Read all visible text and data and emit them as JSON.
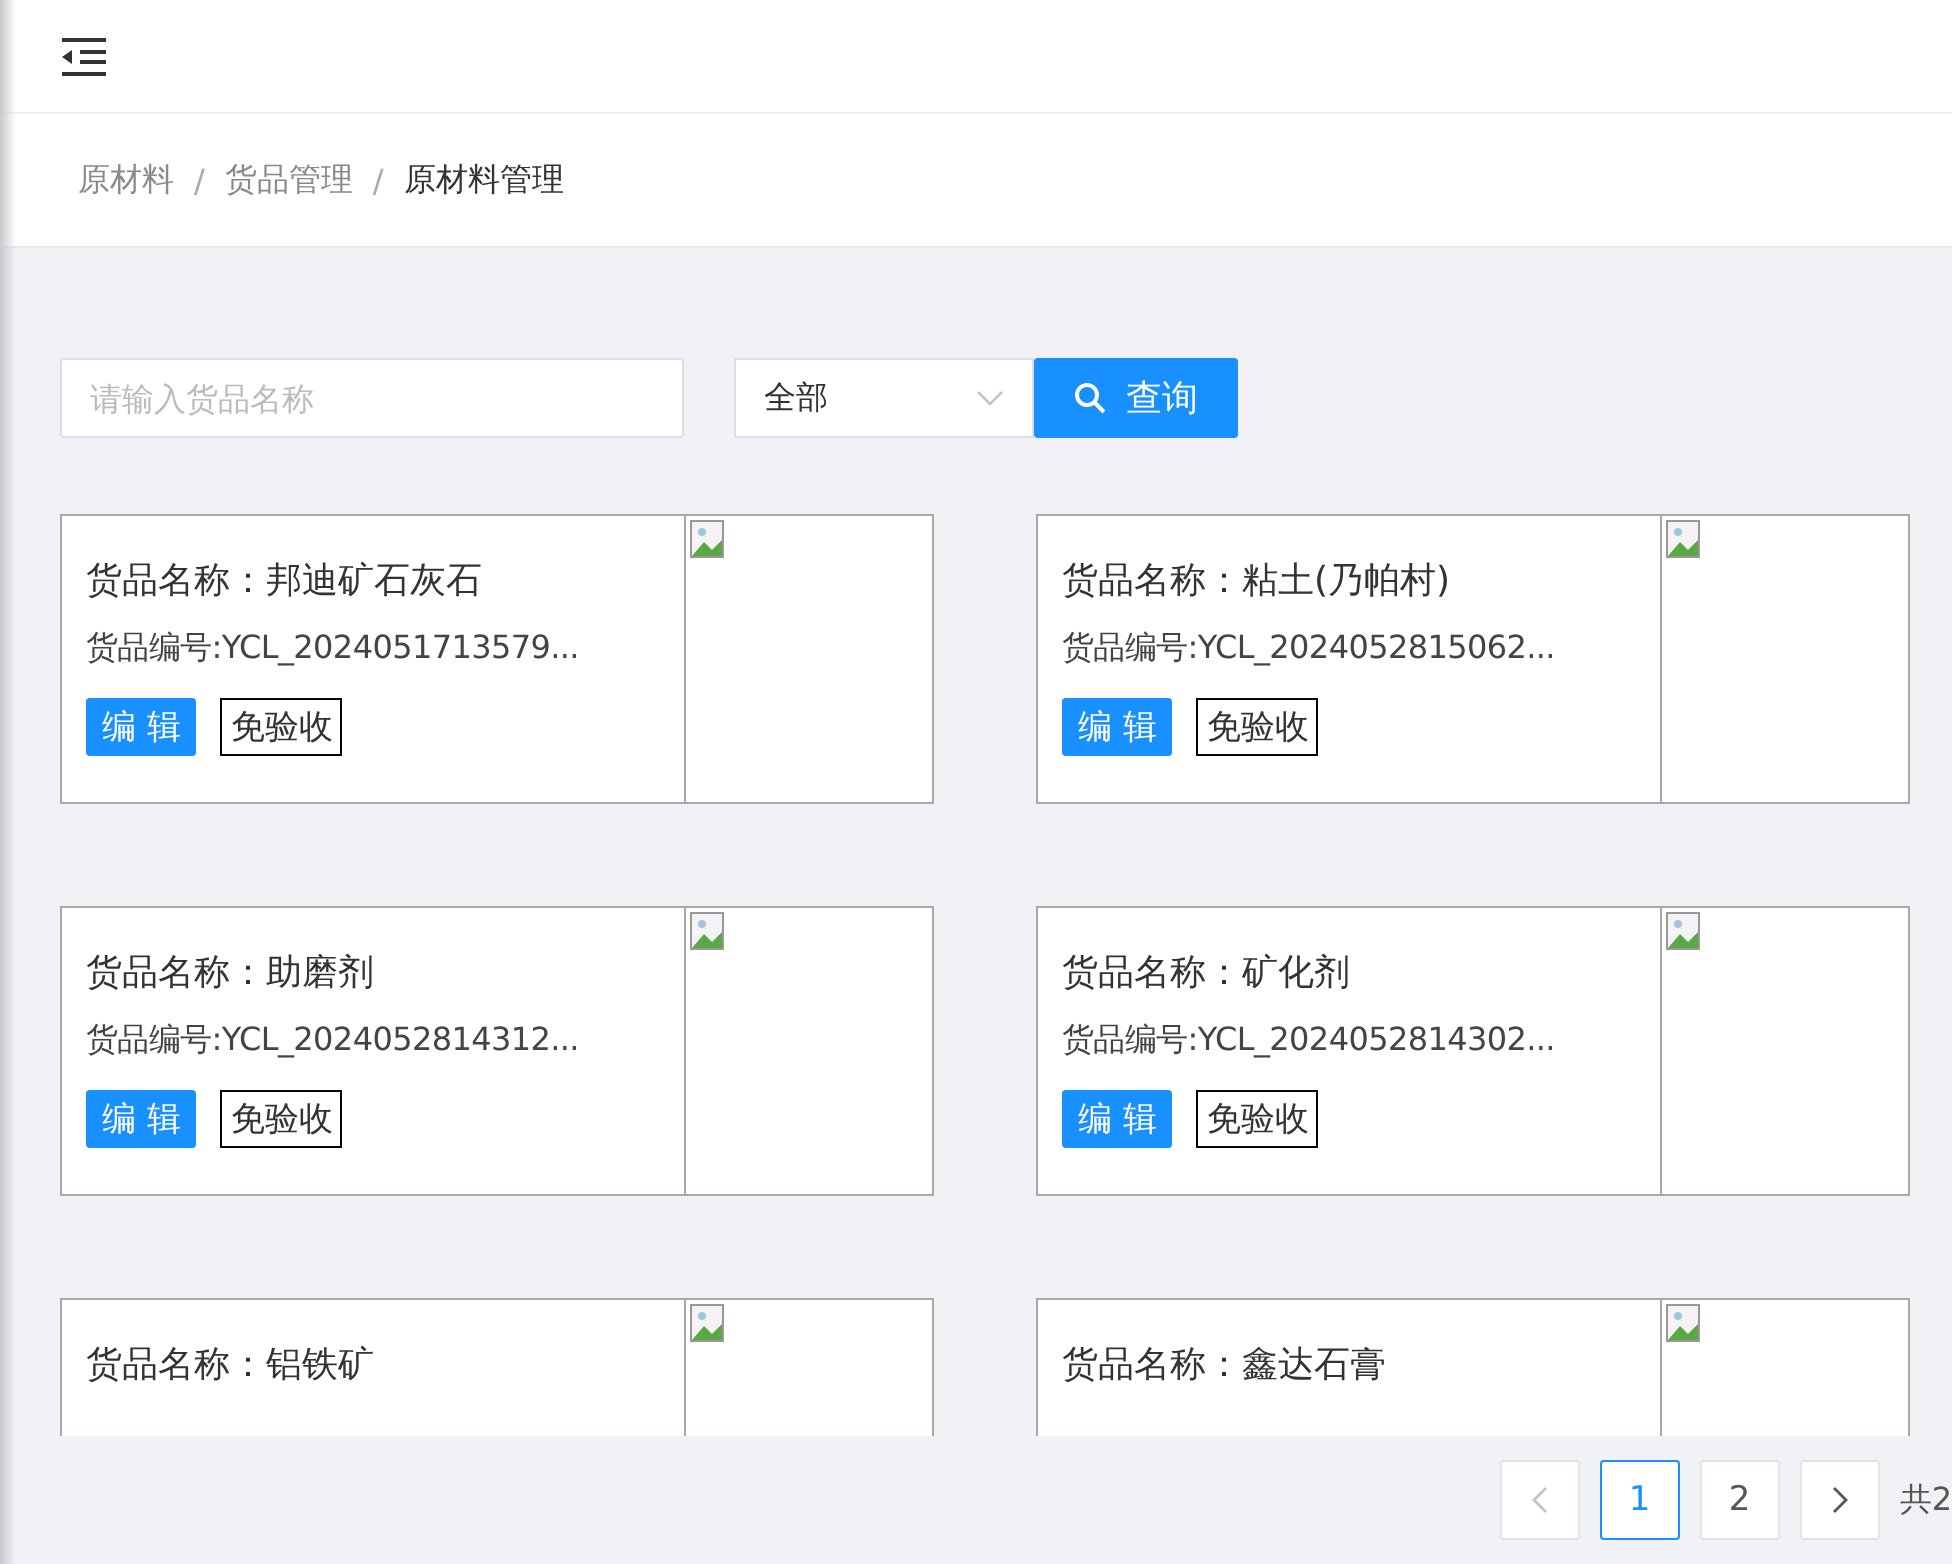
{
  "breadcrumb": [
    {
      "label": "原材料",
      "current": false
    },
    {
      "label": "货品管理",
      "current": false
    },
    {
      "label": "原材料管理",
      "current": true
    }
  ],
  "breadcrumb_separator": "/",
  "search": {
    "placeholder": "请输入货品名称"
  },
  "filter": {
    "value": "全部"
  },
  "query_button": "查询",
  "goods": [
    {
      "name": "货品名称：邦迪矿石灰石",
      "code": "货品编号:YCL_2024051713579...",
      "edit": "编 辑",
      "exempt": "免验收"
    },
    {
      "name": "货品名称：粘土(乃帕村)",
      "code": "货品编号:YCL_2024052815062...",
      "edit": "编 辑",
      "exempt": "免验收"
    },
    {
      "name": "货品名称：助磨剂",
      "code": "货品编号:YCL_2024052814312...",
      "edit": "编 辑",
      "exempt": "免验收"
    },
    {
      "name": "货品名称：矿化剂",
      "code": "货品编号:YCL_2024052814302...",
      "edit": "编 辑",
      "exempt": "免验收"
    },
    {
      "name": "货品名称：铝铁矿"
    },
    {
      "name": "货品名称：鑫达石膏"
    }
  ],
  "pagination": {
    "prev_disabled": true,
    "pages": [
      {
        "label": "1",
        "selected": true
      },
      {
        "label": "2",
        "selected": false
      }
    ],
    "total": "共2"
  }
}
